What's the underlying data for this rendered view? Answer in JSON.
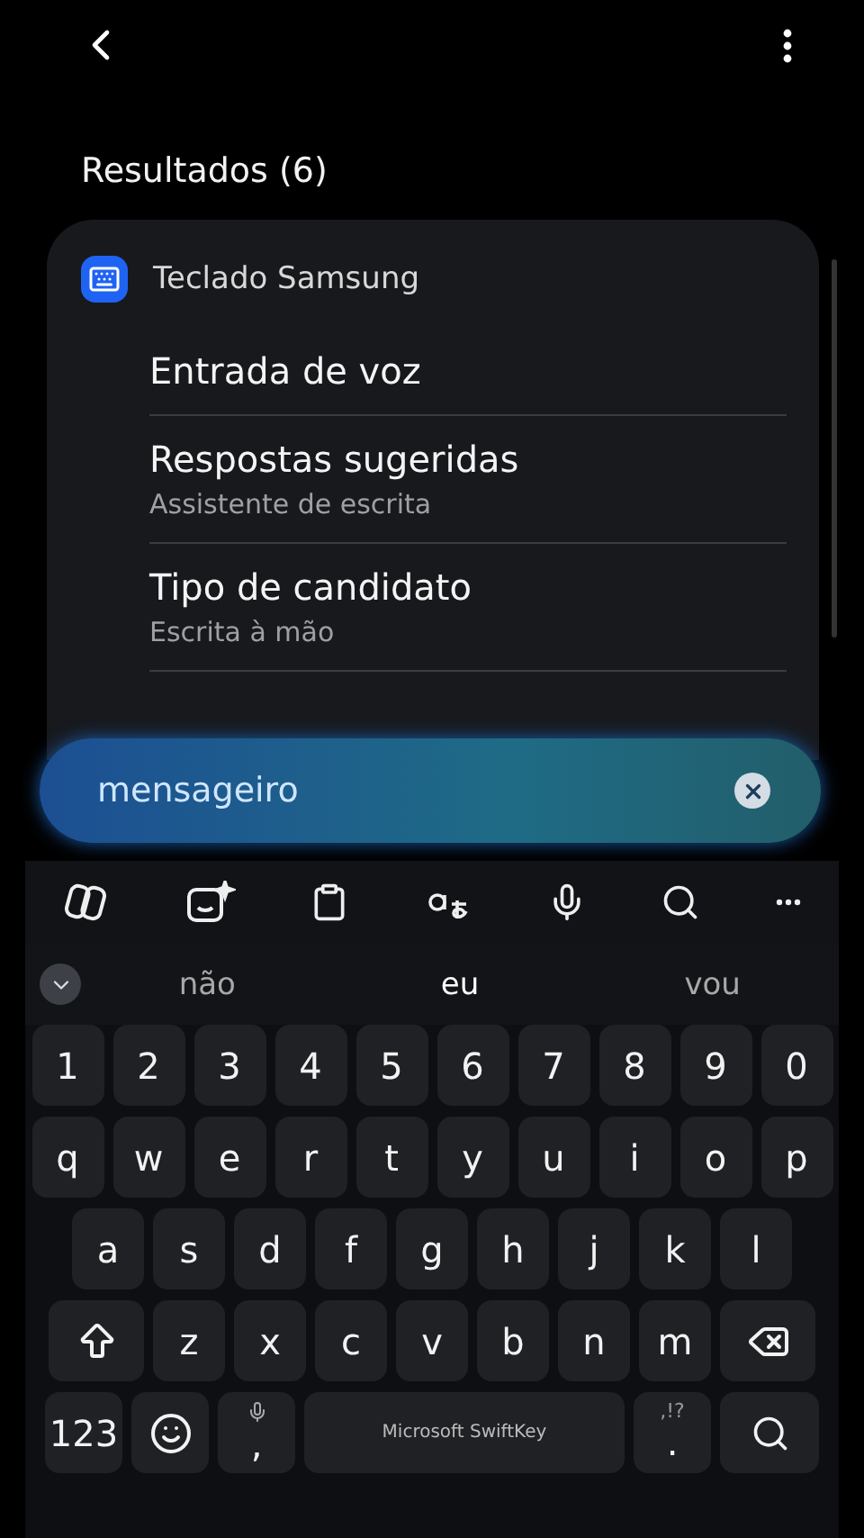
{
  "header": {
    "title": "Resultados (6)"
  },
  "card": {
    "app": "Teclado Samsung",
    "results": [
      {
        "title": "Entrada de voz"
      },
      {
        "title": "Respostas sugeridas",
        "subtitle": "Assistente de escrita"
      },
      {
        "title": "Tipo de candidato",
        "subtitle": "Escrita à mão"
      }
    ]
  },
  "search": {
    "value": "mensageiro"
  },
  "keyboard": {
    "suggestions": [
      {
        "text": "não",
        "selected": false
      },
      {
        "text": "eu",
        "selected": true
      },
      {
        "text": "vou",
        "selected": false
      }
    ],
    "rows": [
      {
        "keys": [
          {
            "kind": "char",
            "label": "1"
          },
          {
            "kind": "char",
            "label": "2"
          },
          {
            "kind": "char",
            "label": "3"
          },
          {
            "kind": "char",
            "label": "4"
          },
          {
            "kind": "char",
            "label": "5"
          },
          {
            "kind": "char",
            "label": "6"
          },
          {
            "kind": "char",
            "label": "7"
          },
          {
            "kind": "char",
            "label": "8"
          },
          {
            "kind": "char",
            "label": "9"
          },
          {
            "kind": "char",
            "label": "0"
          }
        ]
      },
      {
        "keys": [
          {
            "kind": "char",
            "label": "q"
          },
          {
            "kind": "char",
            "label": "w"
          },
          {
            "kind": "char",
            "label": "e"
          },
          {
            "kind": "char",
            "label": "r"
          },
          {
            "kind": "char",
            "label": "t"
          },
          {
            "kind": "char",
            "label": "y"
          },
          {
            "kind": "char",
            "label": "u"
          },
          {
            "kind": "char",
            "label": "i"
          },
          {
            "kind": "char",
            "label": "o"
          },
          {
            "kind": "char",
            "label": "p"
          }
        ]
      },
      {
        "keys": [
          {
            "kind": "char",
            "label": "a"
          },
          {
            "kind": "char",
            "label": "s"
          },
          {
            "kind": "char",
            "label": "d"
          },
          {
            "kind": "char",
            "label": "f"
          },
          {
            "kind": "char",
            "label": "g"
          },
          {
            "kind": "char",
            "label": "h"
          },
          {
            "kind": "char",
            "label": "j"
          },
          {
            "kind": "char",
            "label": "k"
          },
          {
            "kind": "char",
            "label": "l"
          }
        ]
      },
      {
        "keys": [
          {
            "kind": "shift"
          },
          {
            "kind": "char",
            "label": "z"
          },
          {
            "kind": "char",
            "label": "x"
          },
          {
            "kind": "char",
            "label": "c"
          },
          {
            "kind": "char",
            "label": "v"
          },
          {
            "kind": "char",
            "label": "b"
          },
          {
            "kind": "char",
            "label": "n"
          },
          {
            "kind": "char",
            "label": "m"
          },
          {
            "kind": "backspace"
          }
        ]
      },
      {
        "keys": [
          {
            "kind": "mode",
            "label": "123"
          },
          {
            "kind": "emoji"
          },
          {
            "kind": "comma",
            "label": ","
          },
          {
            "kind": "space",
            "label": "Microsoft SwiftKey"
          },
          {
            "kind": "period",
            "label": ".",
            "hint": ",!?"
          },
          {
            "kind": "search"
          }
        ]
      }
    ]
  }
}
